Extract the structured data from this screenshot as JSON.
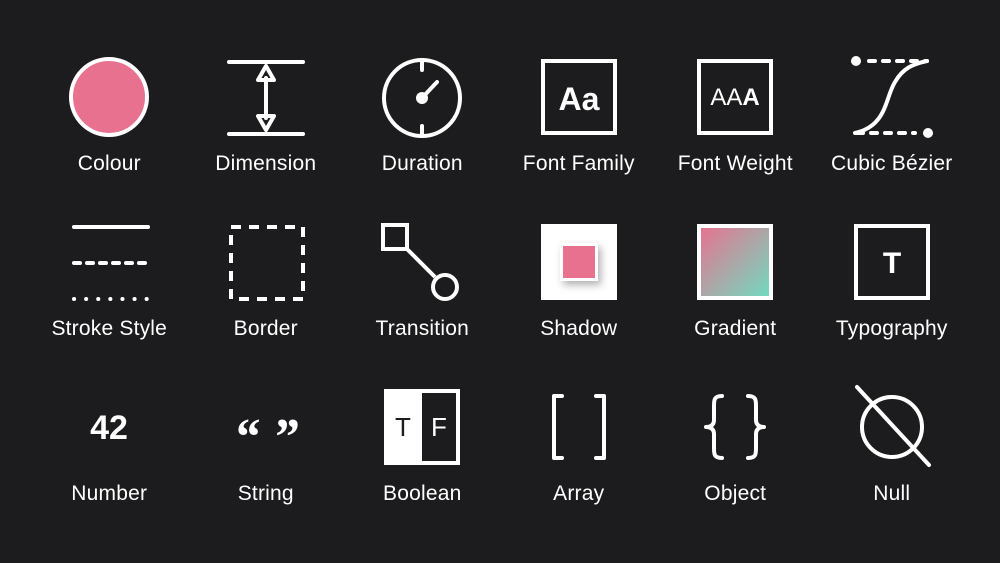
{
  "colors": {
    "background": "#1c1c1e",
    "foreground": "#ffffff",
    "accent_pink": "#e8718f",
    "gradient_end": "#6fdcc0"
  },
  "tokens": [
    {
      "label": "Colour",
      "icon": "colour-swatch-icon"
    },
    {
      "label": "Dimension",
      "icon": "dimension-icon"
    },
    {
      "label": "Duration",
      "icon": "stopwatch-icon"
    },
    {
      "label": "Font Family",
      "icon": "font-family-icon",
      "glyph": "Aa"
    },
    {
      "label": "Font Weight",
      "icon": "font-weight-icon",
      "glyph": "AAA"
    },
    {
      "label": "Cubic Bézier",
      "icon": "cubic-bezier-icon"
    },
    {
      "label": "Stroke Style",
      "icon": "stroke-style-icon"
    },
    {
      "label": "Border",
      "icon": "border-icon"
    },
    {
      "label": "Transition",
      "icon": "transition-icon"
    },
    {
      "label": "Shadow",
      "icon": "shadow-icon"
    },
    {
      "label": "Gradient",
      "icon": "gradient-icon"
    },
    {
      "label": "Typography",
      "icon": "typography-icon",
      "glyph": "T"
    },
    {
      "label": "Number",
      "icon": "number-icon",
      "glyph": "42"
    },
    {
      "label": "String",
      "icon": "string-quotes-icon",
      "glyph": "“ ”"
    },
    {
      "label": "Boolean",
      "icon": "boolean-icon",
      "glyph_true": "T",
      "glyph_false": "F"
    },
    {
      "label": "Array",
      "icon": "array-brackets-icon"
    },
    {
      "label": "Object",
      "icon": "object-braces-icon"
    },
    {
      "label": "Null",
      "icon": "null-icon"
    }
  ]
}
